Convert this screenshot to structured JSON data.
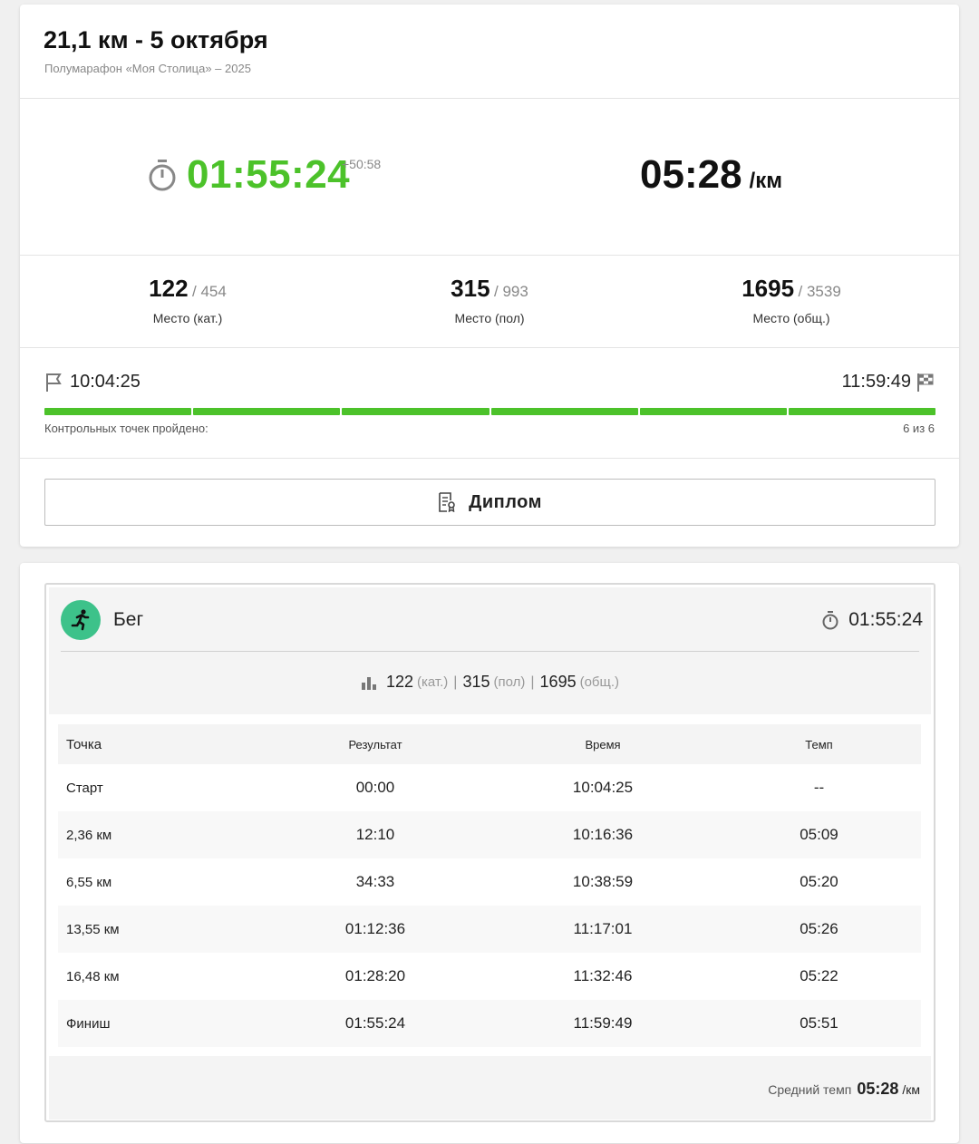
{
  "event": {
    "title": "21,1 км - 5 октября",
    "subtitle": "Полумарафон «Моя Столица» – 2025"
  },
  "result": {
    "time": "01:55:24",
    "diff": "+50:58",
    "pace": "05:28",
    "pace_unit": "/км"
  },
  "places": [
    {
      "num": "122",
      "total": "/ 454",
      "label": "Место (кат.)"
    },
    {
      "num": "315",
      "total": "/ 993",
      "label": "Место (пол)"
    },
    {
      "num": "1695",
      "total": "/ 3539",
      "label": "Место (общ.)"
    }
  ],
  "checkpoints": {
    "start_time": "10:04:25",
    "finish_time": "11:59:49",
    "label": "Контрольных точек пройдено:",
    "count": "6 из 6",
    "passed": 6,
    "total": 6
  },
  "diploma": {
    "label": "Диплом"
  },
  "sport": {
    "name": "Бег",
    "time": "01:55:24",
    "places": {
      "cat": "122",
      "cat_label": "(кат.)",
      "gender": "315",
      "gender_label": "(пол)",
      "overall": "1695",
      "overall_label": "(общ.)"
    }
  },
  "splits": {
    "headers": [
      "Точка",
      "Результат",
      "Время",
      "Темп"
    ],
    "rows": [
      [
        "Старт",
        "00:00",
        "10:04:25",
        "--"
      ],
      [
        "2,36 км",
        "12:10",
        "10:16:36",
        "05:09"
      ],
      [
        "6,55 км",
        "34:33",
        "10:38:59",
        "05:20"
      ],
      [
        "13,55 км",
        "01:12:36",
        "11:17:01",
        "05:26"
      ],
      [
        "16,48 км",
        "01:28:20",
        "11:32:46",
        "05:22"
      ],
      [
        "Финиш",
        "01:55:24",
        "11:59:49",
        "05:51"
      ]
    ]
  },
  "average": {
    "label": "Средний темп",
    "value": "05:28",
    "unit": "/км"
  },
  "colors": {
    "accent_green": "#4cc22a",
    "run_icon_bg": "#3dc28a"
  }
}
